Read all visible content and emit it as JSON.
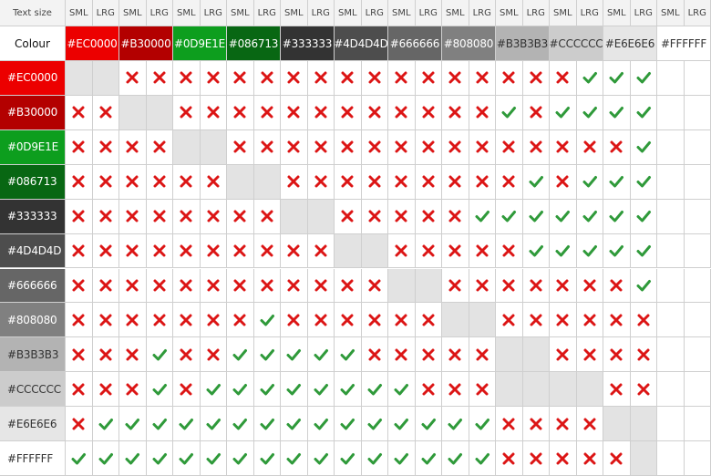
{
  "header": {
    "text_size_label": "Text size",
    "colour_label": "Colour",
    "size_labels": [
      "SML",
      "LRG"
    ]
  },
  "colours": [
    {
      "hex": "#EC0000",
      "label": "#EC0000",
      "text_color": "#ffffff"
    },
    {
      "hex": "#B30000",
      "label": "#B30000",
      "text_color": "#ffffff"
    },
    {
      "hex": "#0D9E1E",
      "label": "#0D9E1E",
      "text_color": "#ffffff"
    },
    {
      "hex": "#086713",
      "label": "#086713",
      "text_color": "#ffffff"
    },
    {
      "hex": "#333333",
      "label": "#333333",
      "text_color": "#ffffff"
    },
    {
      "hex": "#4D4D4D",
      "label": "#4D4D4D",
      "text_color": "#ffffff"
    },
    {
      "hex": "#666666",
      "label": "#666666",
      "text_color": "#ffffff"
    },
    {
      "hex": "#808080",
      "label": "#808080",
      "text_color": "#ffffff"
    },
    {
      "hex": "#B3B3B3",
      "label": "#B3B3B3",
      "text_color": "#333333"
    },
    {
      "hex": "#CCCCCC",
      "label": "#CCCCCC",
      "text_color": "#333333"
    },
    {
      "hex": "#E6E6E6",
      "label": "#E6E6E6",
      "text_color": "#333333"
    },
    {
      "hex": "#FFFFFF",
      "label": "#FFFFFF",
      "text_color": "#333333"
    }
  ],
  "legend": {
    "x": "fail",
    "v": "pass",
    "-": "same colour (n/a)"
  },
  "matrix": [
    "--xxxxxxxxxxxxxxxxxvvv",
    "xx--xxxxxxxxxxxxvxvvvv",
    "xxxx--xxxxxxxxxxxxxxxv",
    "xxxxxx--xxxxxxxxxvxvvv",
    "xxxxxxxx--xxxxxvvvvvvv",
    "xxxxxxxxxx--xxxxxvvvvv",
    "xxxxxxxxxxxx--xxxxxxxv",
    "xxxxxxxvxxxxxx--xxxxxx",
    "xxxvxxvvvvvxxxxx--xxxx",
    "xxxvxvvvvvvvvxxx----xx",
    "xvvvvvvvvvvvvvvvxxxx--",
    "vvvvvvvvvvvvvvvvxxxxx-"
  ],
  "colors": {
    "cross": "#DC1515",
    "tick": "#2F9A3A",
    "same_cell": "#E3E3E3",
    "header_bg": "#F3F3F3",
    "grid_line": "#CFCFCF"
  }
}
